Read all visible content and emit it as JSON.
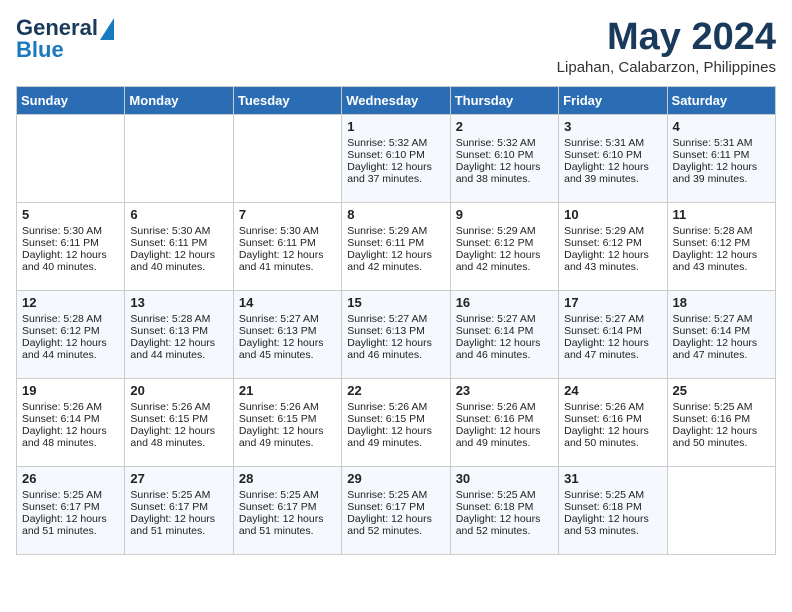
{
  "header": {
    "logo_line1": "General",
    "logo_line2": "Blue",
    "month": "May 2024",
    "location": "Lipahan, Calabarzon, Philippines"
  },
  "weekdays": [
    "Sunday",
    "Monday",
    "Tuesday",
    "Wednesday",
    "Thursday",
    "Friday",
    "Saturday"
  ],
  "weeks": [
    [
      {
        "day": "",
        "data": ""
      },
      {
        "day": "",
        "data": ""
      },
      {
        "day": "",
        "data": ""
      },
      {
        "day": "1",
        "data": "Sunrise: 5:32 AM\nSunset: 6:10 PM\nDaylight: 12 hours\nand 37 minutes."
      },
      {
        "day": "2",
        "data": "Sunrise: 5:32 AM\nSunset: 6:10 PM\nDaylight: 12 hours\nand 38 minutes."
      },
      {
        "day": "3",
        "data": "Sunrise: 5:31 AM\nSunset: 6:10 PM\nDaylight: 12 hours\nand 39 minutes."
      },
      {
        "day": "4",
        "data": "Sunrise: 5:31 AM\nSunset: 6:11 PM\nDaylight: 12 hours\nand 39 minutes."
      }
    ],
    [
      {
        "day": "5",
        "data": "Sunrise: 5:30 AM\nSunset: 6:11 PM\nDaylight: 12 hours\nand 40 minutes."
      },
      {
        "day": "6",
        "data": "Sunrise: 5:30 AM\nSunset: 6:11 PM\nDaylight: 12 hours\nand 40 minutes."
      },
      {
        "day": "7",
        "data": "Sunrise: 5:30 AM\nSunset: 6:11 PM\nDaylight: 12 hours\nand 41 minutes."
      },
      {
        "day": "8",
        "data": "Sunrise: 5:29 AM\nSunset: 6:11 PM\nDaylight: 12 hours\nand 42 minutes."
      },
      {
        "day": "9",
        "data": "Sunrise: 5:29 AM\nSunset: 6:12 PM\nDaylight: 12 hours\nand 42 minutes."
      },
      {
        "day": "10",
        "data": "Sunrise: 5:29 AM\nSunset: 6:12 PM\nDaylight: 12 hours\nand 43 minutes."
      },
      {
        "day": "11",
        "data": "Sunrise: 5:28 AM\nSunset: 6:12 PM\nDaylight: 12 hours\nand 43 minutes."
      }
    ],
    [
      {
        "day": "12",
        "data": "Sunrise: 5:28 AM\nSunset: 6:12 PM\nDaylight: 12 hours\nand 44 minutes."
      },
      {
        "day": "13",
        "data": "Sunrise: 5:28 AM\nSunset: 6:13 PM\nDaylight: 12 hours\nand 44 minutes."
      },
      {
        "day": "14",
        "data": "Sunrise: 5:27 AM\nSunset: 6:13 PM\nDaylight: 12 hours\nand 45 minutes."
      },
      {
        "day": "15",
        "data": "Sunrise: 5:27 AM\nSunset: 6:13 PM\nDaylight: 12 hours\nand 46 minutes."
      },
      {
        "day": "16",
        "data": "Sunrise: 5:27 AM\nSunset: 6:14 PM\nDaylight: 12 hours\nand 46 minutes."
      },
      {
        "day": "17",
        "data": "Sunrise: 5:27 AM\nSunset: 6:14 PM\nDaylight: 12 hours\nand 47 minutes."
      },
      {
        "day": "18",
        "data": "Sunrise: 5:27 AM\nSunset: 6:14 PM\nDaylight: 12 hours\nand 47 minutes."
      }
    ],
    [
      {
        "day": "19",
        "data": "Sunrise: 5:26 AM\nSunset: 6:14 PM\nDaylight: 12 hours\nand 48 minutes."
      },
      {
        "day": "20",
        "data": "Sunrise: 5:26 AM\nSunset: 6:15 PM\nDaylight: 12 hours\nand 48 minutes."
      },
      {
        "day": "21",
        "data": "Sunrise: 5:26 AM\nSunset: 6:15 PM\nDaylight: 12 hours\nand 49 minutes."
      },
      {
        "day": "22",
        "data": "Sunrise: 5:26 AM\nSunset: 6:15 PM\nDaylight: 12 hours\nand 49 minutes."
      },
      {
        "day": "23",
        "data": "Sunrise: 5:26 AM\nSunset: 6:16 PM\nDaylight: 12 hours\nand 49 minutes."
      },
      {
        "day": "24",
        "data": "Sunrise: 5:26 AM\nSunset: 6:16 PM\nDaylight: 12 hours\nand 50 minutes."
      },
      {
        "day": "25",
        "data": "Sunrise: 5:25 AM\nSunset: 6:16 PM\nDaylight: 12 hours\nand 50 minutes."
      }
    ],
    [
      {
        "day": "26",
        "data": "Sunrise: 5:25 AM\nSunset: 6:17 PM\nDaylight: 12 hours\nand 51 minutes."
      },
      {
        "day": "27",
        "data": "Sunrise: 5:25 AM\nSunset: 6:17 PM\nDaylight: 12 hours\nand 51 minutes."
      },
      {
        "day": "28",
        "data": "Sunrise: 5:25 AM\nSunset: 6:17 PM\nDaylight: 12 hours\nand 51 minutes."
      },
      {
        "day": "29",
        "data": "Sunrise: 5:25 AM\nSunset: 6:17 PM\nDaylight: 12 hours\nand 52 minutes."
      },
      {
        "day": "30",
        "data": "Sunrise: 5:25 AM\nSunset: 6:18 PM\nDaylight: 12 hours\nand 52 minutes."
      },
      {
        "day": "31",
        "data": "Sunrise: 5:25 AM\nSunset: 6:18 PM\nDaylight: 12 hours\nand 53 minutes."
      },
      {
        "day": "",
        "data": ""
      }
    ]
  ]
}
